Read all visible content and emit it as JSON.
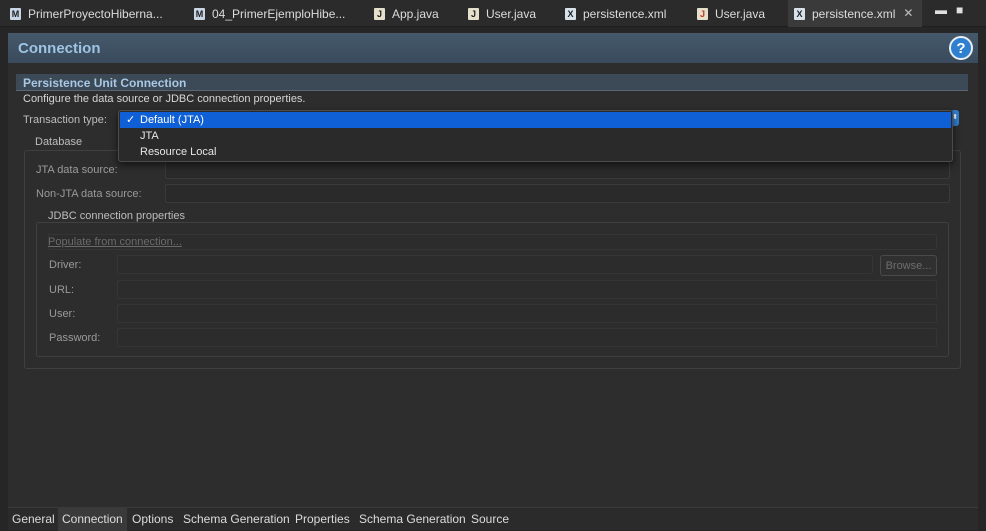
{
  "tabs": [
    {
      "label": "PrimerProyectoHiberna...",
      "icon": "manifest-icon"
    },
    {
      "label": "04_PrimerEjemploHibe...",
      "icon": "manifest-icon"
    },
    {
      "label": "App.java",
      "icon": "java-file-icon"
    },
    {
      "label": "User.java",
      "icon": "java-file-icon"
    },
    {
      "label": "persistence.xml",
      "icon": "xml-file-icon"
    },
    {
      "label": "User.java",
      "icon": "java-error-file-icon"
    },
    {
      "label": "persistence.xml",
      "icon": "xml-file-icon"
    }
  ],
  "window_controls": {
    "minimize": "▬",
    "maximize": "■"
  },
  "page": {
    "title": "Connection",
    "help": "?"
  },
  "section": {
    "title": "Persistence Unit Connection",
    "description": "Configure the data source or JDBC connection properties."
  },
  "transaction": {
    "label": "Transaction type:",
    "options": [
      "Default (JTA)",
      "JTA",
      "Resource Local"
    ],
    "selected": "Default (JTA)"
  },
  "database": {
    "title": "Database",
    "jta_label": "JTA data source:",
    "non_jta_label": "Non-JTA data source:",
    "jdbc": {
      "title": "JDBC connection properties",
      "populate_link": "Populate from connection...",
      "driver_label": "Driver:",
      "browse": "Browse...",
      "url_label": "URL:",
      "user_label": "User:",
      "password_label": "Password:"
    }
  },
  "bottom_tabs": [
    "General",
    "Connection",
    "Options",
    "Schema Generation",
    "Properties",
    "Schema Generation",
    "Source"
  ],
  "colors": {
    "accent": "#0f5fd6",
    "header_text": "#9fc4e3",
    "help": "#2f7fd0"
  }
}
